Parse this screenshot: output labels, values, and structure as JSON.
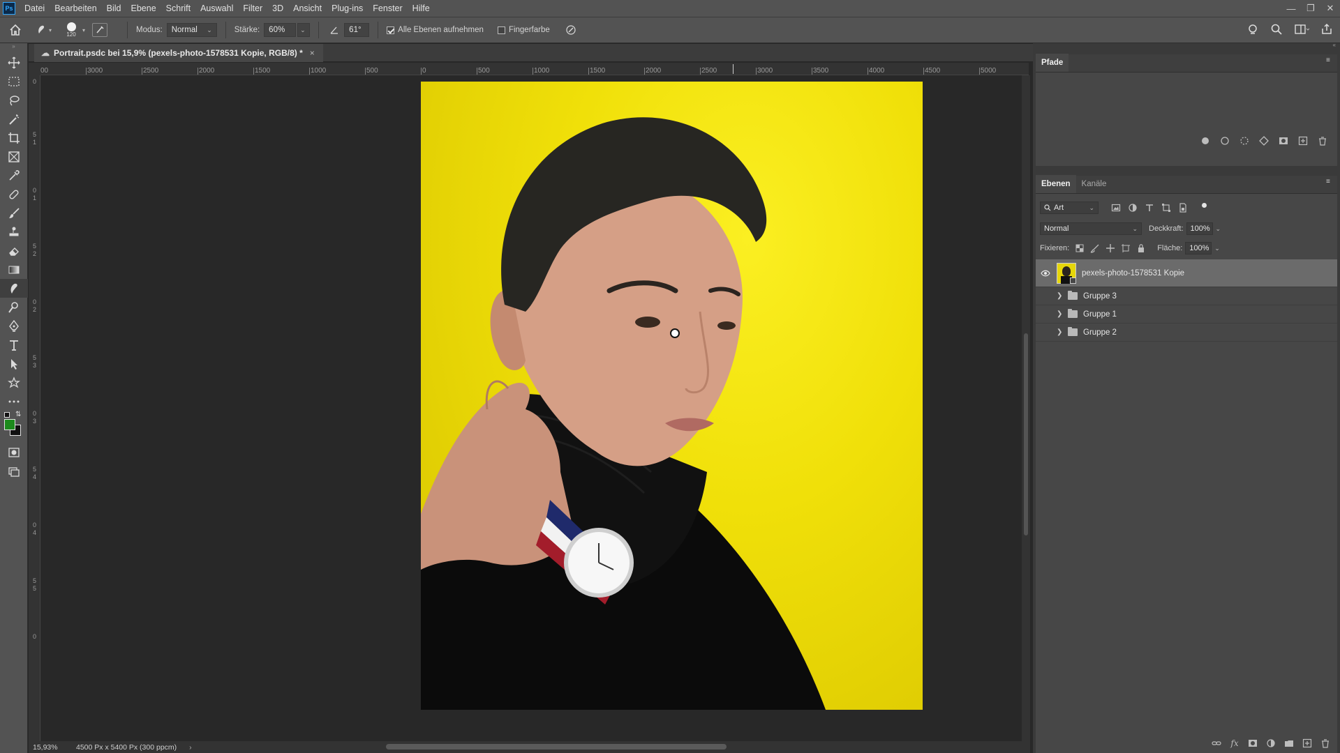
{
  "menubar": {
    "logo": "Ps",
    "items": [
      "Datei",
      "Bearbeiten",
      "Bild",
      "Ebene",
      "Schrift",
      "Auswahl",
      "Filter",
      "3D",
      "Ansicht",
      "Plug-ins",
      "Fenster",
      "Hilfe"
    ]
  },
  "options": {
    "brush_size": "120",
    "mode_label": "Modus:",
    "mode_value": "Normal",
    "strength_label": "Stärke:",
    "strength_value": "60%",
    "angle_value": "61°",
    "sample_all_label": "Alle Ebenen aufnehmen",
    "sample_all_checked": true,
    "finger_label": "Fingerfarbe",
    "finger_checked": false
  },
  "document": {
    "tab_title": "Portrait.psdc bei 15,9% (pexels-photo-1578531 Kopie, RGB/8) *",
    "close": "×",
    "ruler_top": [
      "00",
      "3000",
      "2500",
      "2000",
      "1500",
      "1000",
      "500",
      "0",
      "500",
      "1000",
      "1500",
      "2000",
      "2500",
      "3000",
      "3500",
      "4000",
      "4500",
      "5000"
    ],
    "ruler_left": [
      "0",
      "5",
      "1",
      "0",
      "1",
      "5",
      "2",
      "0",
      "2",
      "5",
      "3",
      "0",
      "3",
      "5",
      "4",
      "0",
      "4",
      "5",
      "5",
      "0"
    ]
  },
  "status": {
    "zoom": "15,93%",
    "doc_info": "4500 Px x 5400 Px (300 ppcm)",
    "arrow": "›"
  },
  "colors": {
    "foreground": "#1c8a1c",
    "background": "#101010",
    "accent": "#31a8ff"
  },
  "paths_panel": {
    "tab": "Pfade"
  },
  "layers_panel": {
    "tabs": [
      "Ebenen",
      "Kanäle"
    ],
    "filter_value": "Art",
    "blend_mode": "Normal",
    "opacity_label": "Deckkraft:",
    "opacity_value": "100%",
    "lock_label": "Fixieren:",
    "fill_label": "Fläche:",
    "fill_value": "100%",
    "layers": [
      {
        "name": "pexels-photo-1578531 Kopie",
        "type": "smart-object",
        "visible": true,
        "selected": true
      },
      {
        "name": "Gruppe 3",
        "type": "group",
        "visible": false,
        "selected": false
      },
      {
        "name": "Gruppe 1",
        "type": "group",
        "visible": false,
        "selected": false
      },
      {
        "name": "Gruppe 2",
        "type": "group",
        "visible": false,
        "selected": false
      }
    ]
  }
}
